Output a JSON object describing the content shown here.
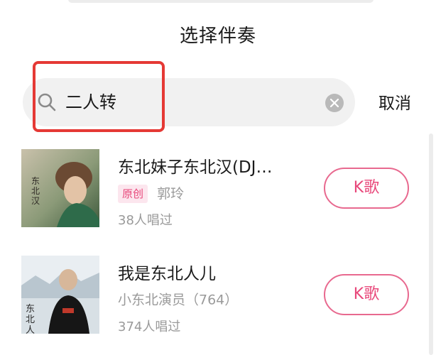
{
  "page": {
    "title": "选择伴奏"
  },
  "search": {
    "value": "二人转",
    "cancel_label": "取消"
  },
  "results": [
    {
      "title": "东北妹子东北汉(DJ…",
      "badge": "原创",
      "artist": "郭玲",
      "sung_count": "38人唱过",
      "button_label": "K歌",
      "cover_text": "东北汉"
    },
    {
      "title": "我是东北人儿",
      "badge": "",
      "artist": "小东北演员（764）",
      "sung_count": "374人唱过",
      "button_label": "K歌",
      "cover_text": "东北人"
    }
  ],
  "colors": {
    "accent": "#e8477a",
    "highlight": "#e53935",
    "search_bg": "#f1f1f1"
  }
}
